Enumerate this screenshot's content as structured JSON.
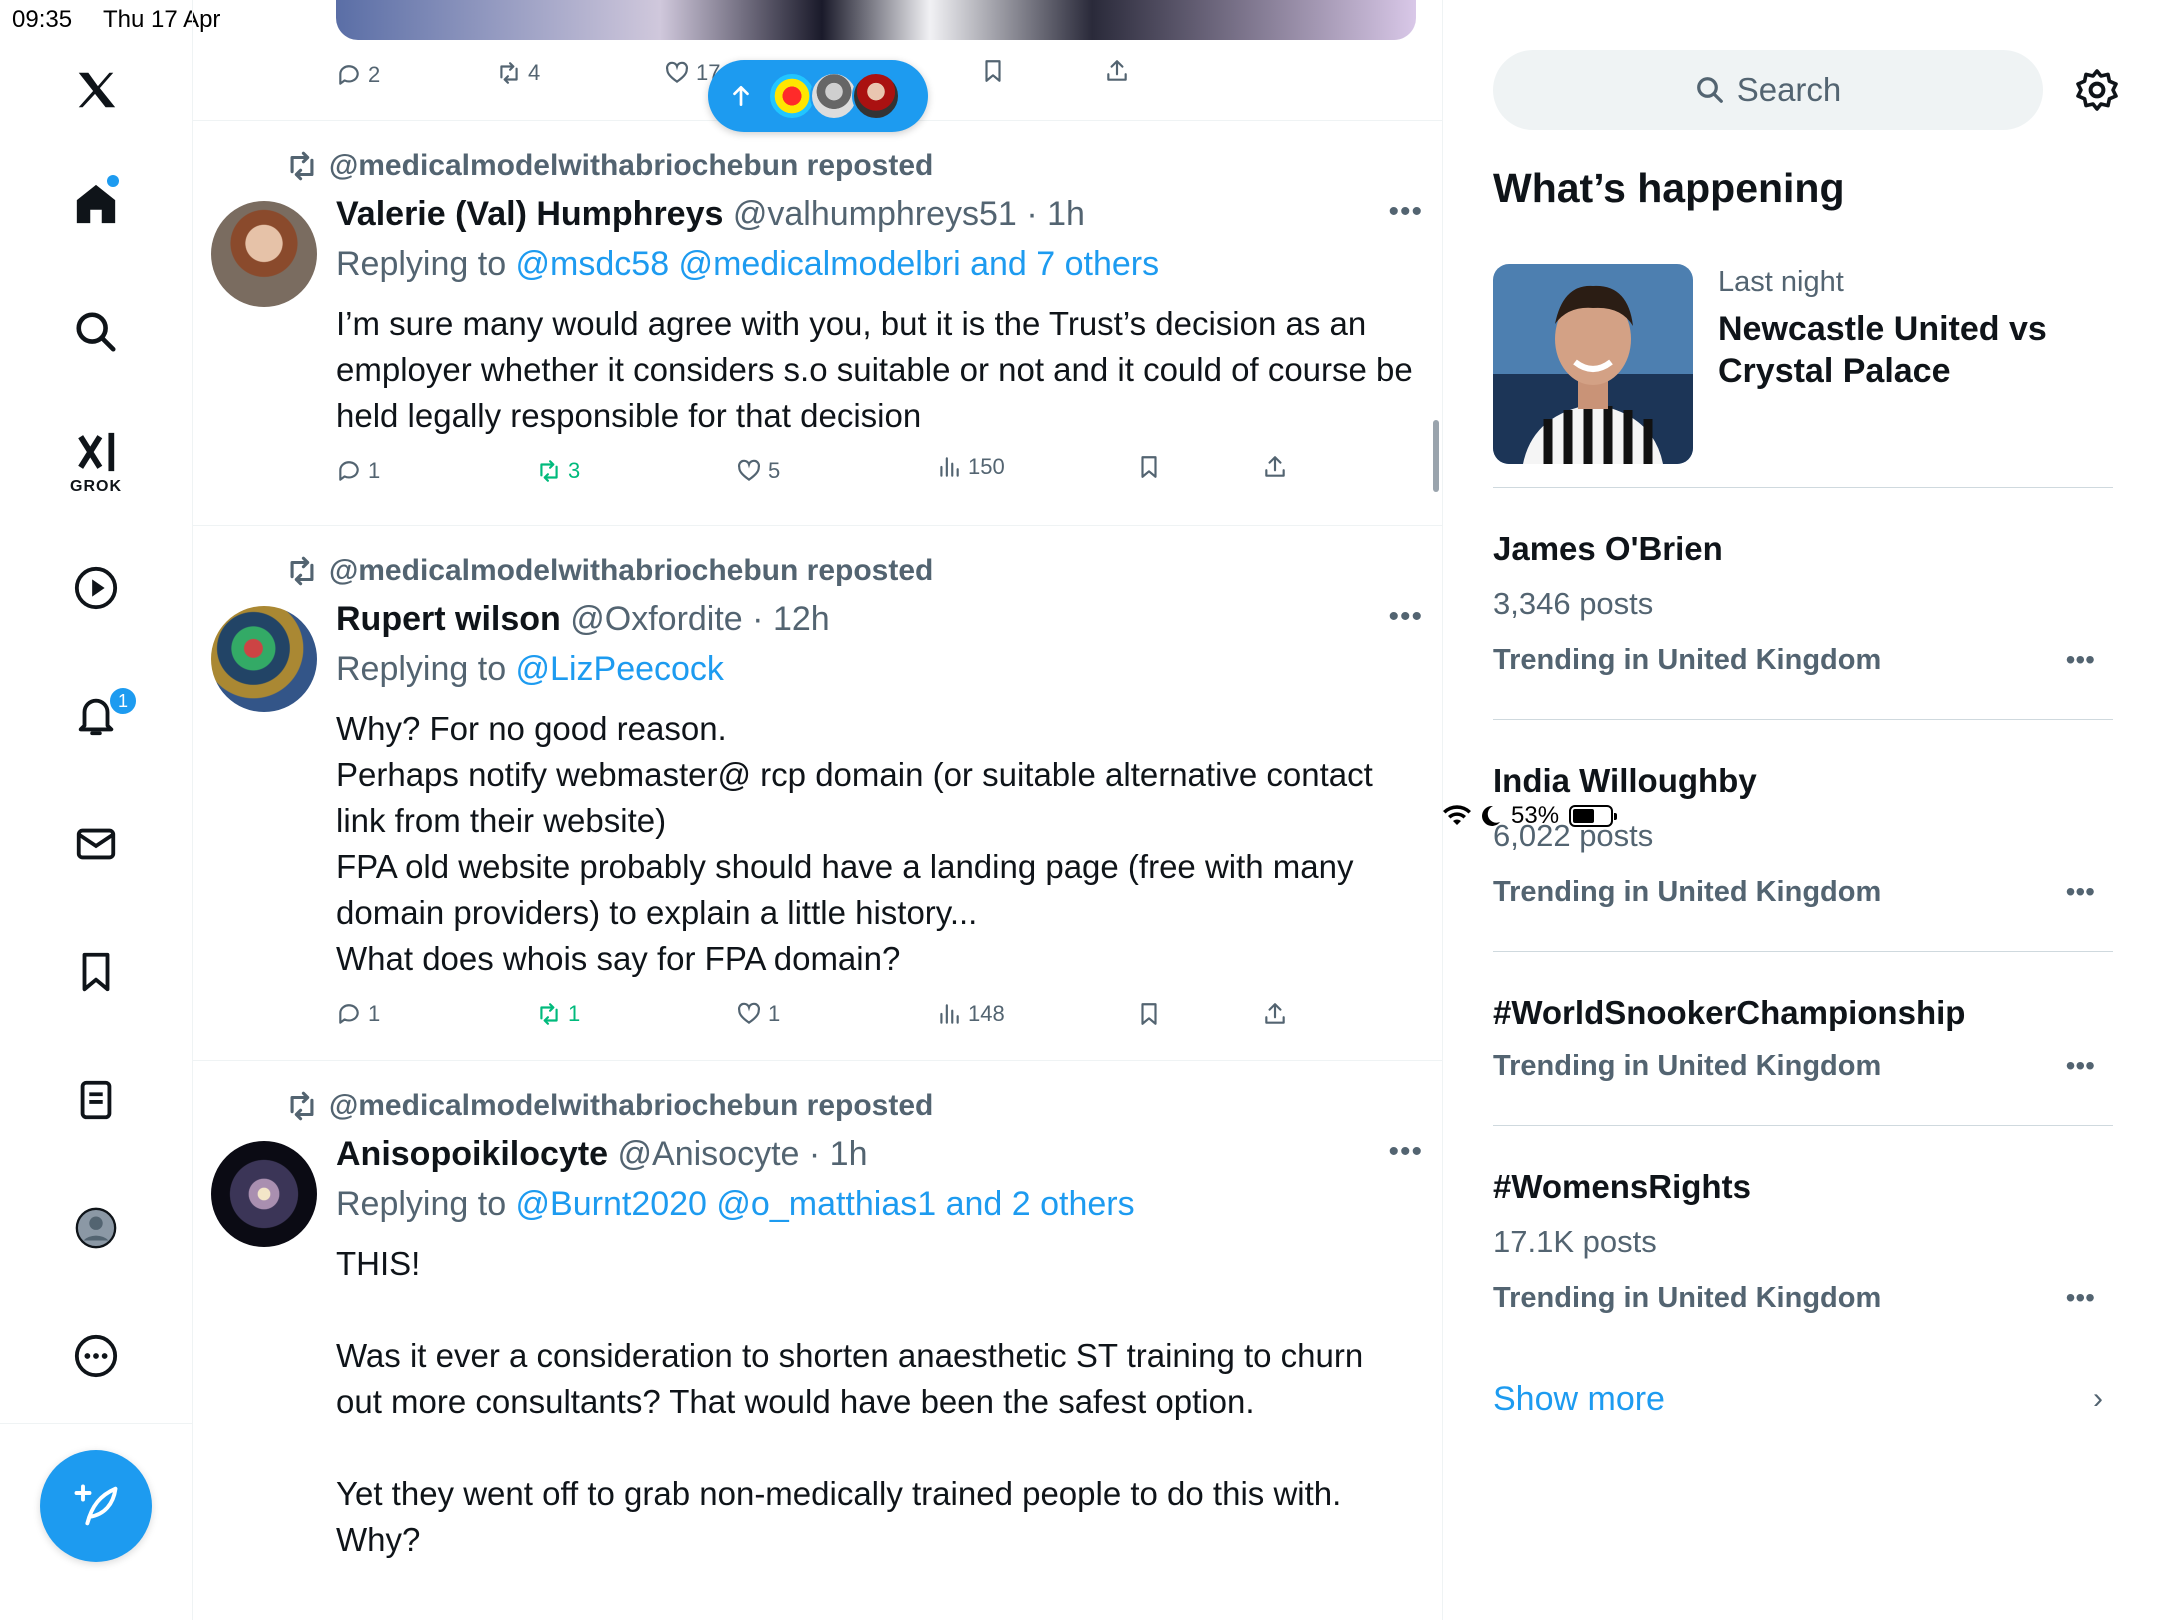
{
  "status": {
    "time": "09:35",
    "date": "Thu 17 Apr",
    "battery": "53%"
  },
  "nav": {
    "grok_label": "GROK",
    "notifications_badge": "1",
    "items": [
      "x-logo-icon",
      "home-icon",
      "search-icon",
      "grok-icon",
      "video-icon",
      "bell-icon",
      "mail-icon",
      "bookmark-icon",
      "lists-icon",
      "profile-icon",
      "more-icon"
    ]
  },
  "top_tweet": {
    "replies": "2",
    "reposts": "4",
    "likes": "17"
  },
  "tweets": [
    {
      "repost_by": "@medicalmodelwithabriochebun reposted",
      "name": "Valerie (Val) Humphreys",
      "handle": "@valhumphreys51",
      "time": "· 1h",
      "replying_prefix": "Replying to ",
      "replying_to": "@msdc58 @medicalmodelbri and 7 others",
      "body": "I’m sure many would agree with you, but it is the Trust’s decision as an employer whether it considers s.o suitable or not and it could of course be held legally responsible for that decision",
      "replies": "1",
      "reposts": "3",
      "likes": "5",
      "views": "150"
    },
    {
      "repost_by": "@medicalmodelwithabriochebun reposted",
      "name": "Rupert wilson",
      "handle": "@Oxfordite",
      "time": "· 12h",
      "replying_prefix": "Replying to ",
      "replying_to": "@LizPeecock",
      "body": "Why? For no good reason.\nPerhaps notify webmaster@ rcp domain (or suitable alternative contact link from their website)\nFPA old website probably should have a landing page (free with many domain providers) to explain a little history...\nWhat does whois say for FPA domain?",
      "replies": "1",
      "reposts": "1",
      "likes": "1",
      "views": "148"
    },
    {
      "repost_by": "@medicalmodelwithabriochebun reposted",
      "name": "Anisopoikilocyte",
      "handle": "@Anisocyte",
      "time": "· 1h",
      "replying_prefix": "Replying to ",
      "replying_to": "@Burnt2020 @o_matthias1 and 2 others",
      "body": "THIS!\n\nWas it ever a consideration to shorten anaesthetic ST training to churn out more consultants? That would have been the safest option.\n\nYet they went off to grab non-medically trained people to do this with. Why?"
    }
  ],
  "right": {
    "search_placeholder": "Search",
    "section_title": "What’s happening",
    "featured": {
      "sub": "Last night",
      "title": "Newcastle United vs Crystal Palace"
    },
    "trends": [
      {
        "title": "James O'Brien",
        "count": "3,346 posts",
        "location": "Trending in United Kingdom"
      },
      {
        "title": "India Willoughby",
        "count": "6,022 posts",
        "location": "Trending in United Kingdom"
      },
      {
        "title": "#WorldSnookerChampionship",
        "count": "",
        "location": "Trending in United Kingdom"
      },
      {
        "title": "#WomensRights",
        "count": "17.1K posts",
        "location": "Trending in United Kingdom"
      }
    ],
    "show_more": "Show more"
  },
  "colors": {
    "accent": "#1d9bf0",
    "repost_green": "#00ba7c",
    "secondary_text": "#536471"
  }
}
